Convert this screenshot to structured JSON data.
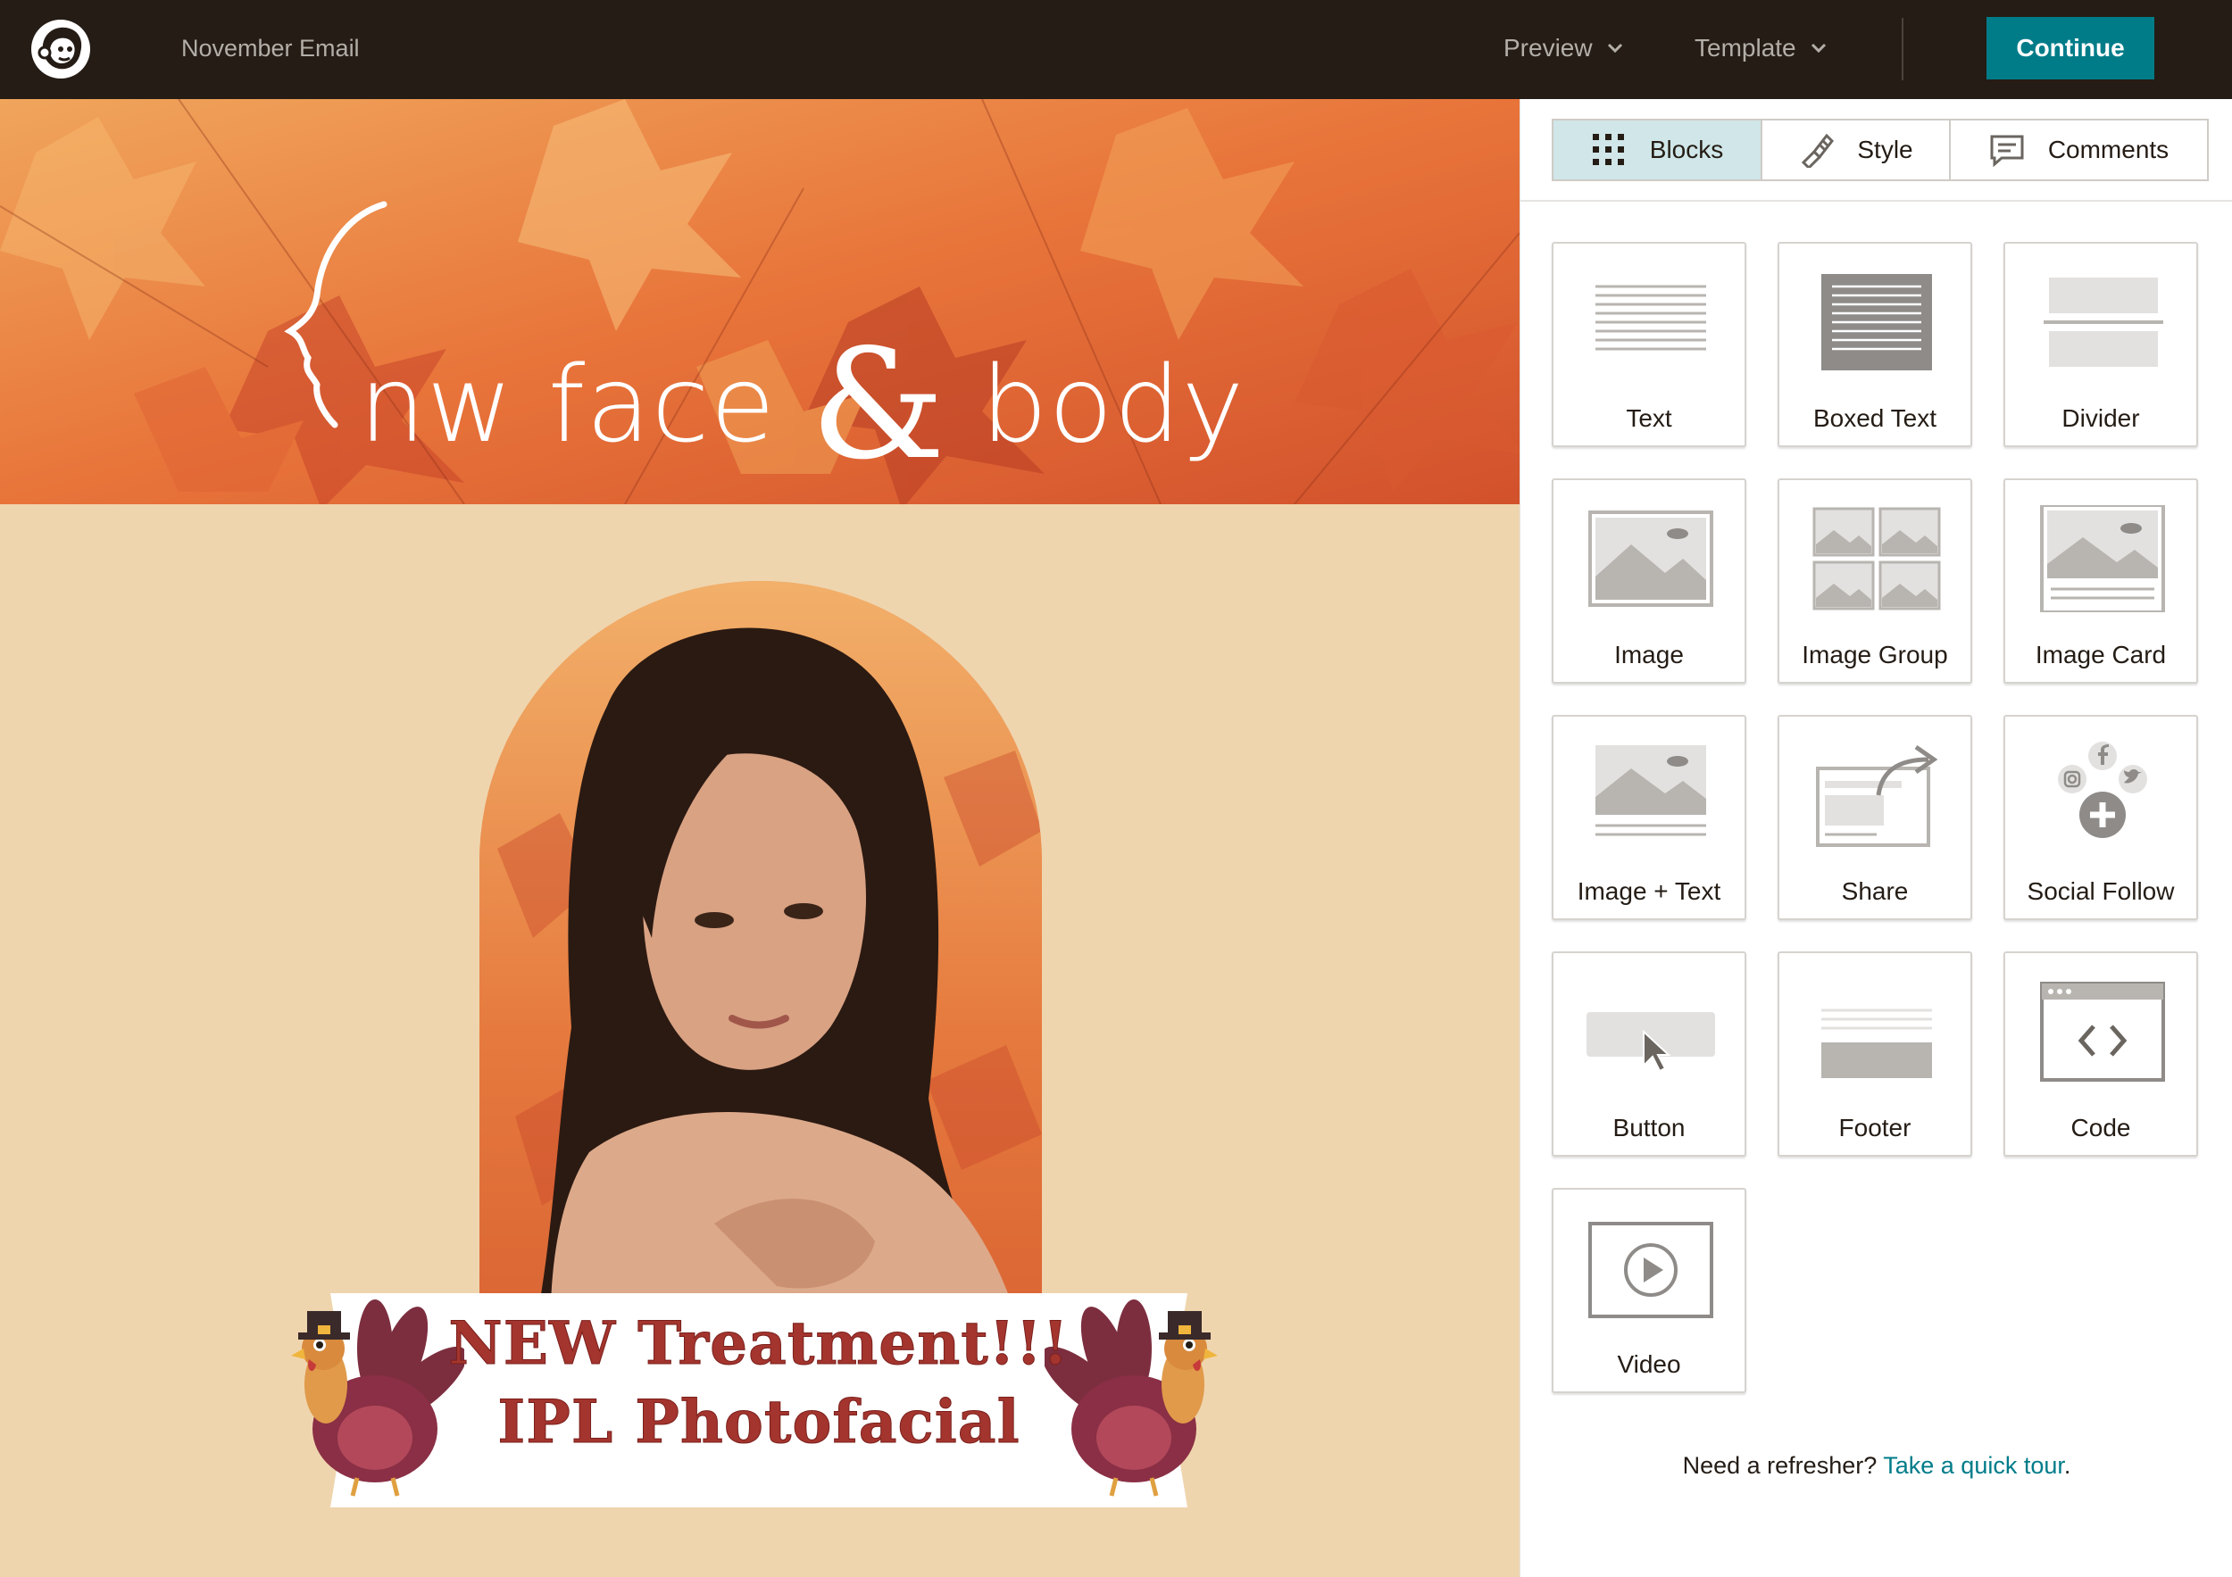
{
  "topbar": {
    "logo_icon": "mailchimp-freddie-icon",
    "document_title": "November Email",
    "preview_label": "Preview",
    "template_label": "Template",
    "continue_label": "Continue",
    "accent_color": "#007c89",
    "bar_color": "#241c15"
  },
  "email": {
    "brand_left": "nw face",
    "brand_amp": "&",
    "brand_right": "body",
    "banner_line1": "NEW Treatment!!!",
    "banner_line2": "IPL Photofacial",
    "background_color": "#efd5ae"
  },
  "panel": {
    "tabs": [
      {
        "label": "Blocks",
        "icon": "grid-dots-icon",
        "active": true
      },
      {
        "label": "Style",
        "icon": "paint-brush-icon",
        "active": false
      },
      {
        "label": "Comments",
        "icon": "comment-icon",
        "active": false
      }
    ],
    "blocks": [
      {
        "label": "Text",
        "icon": "text-block-icon"
      },
      {
        "label": "Boxed Text",
        "icon": "boxed-text-icon"
      },
      {
        "label": "Divider",
        "icon": "divider-icon"
      },
      {
        "label": "Image",
        "icon": "image-icon"
      },
      {
        "label": "Image Group",
        "icon": "image-group-icon"
      },
      {
        "label": "Image Card",
        "icon": "image-card-icon"
      },
      {
        "label": "Image + Text",
        "icon": "image-text-icon"
      },
      {
        "label": "Share",
        "icon": "share-icon"
      },
      {
        "label": "Social Follow",
        "icon": "social-follow-icon"
      },
      {
        "label": "Button",
        "icon": "button-icon"
      },
      {
        "label": "Footer",
        "icon": "footer-icon"
      },
      {
        "label": "Code",
        "icon": "code-icon"
      },
      {
        "label": "Video",
        "icon": "video-icon"
      }
    ],
    "refresher_text": "Need a refresher?",
    "refresher_link": "Take a quick tour",
    "refresher_end": "."
  }
}
